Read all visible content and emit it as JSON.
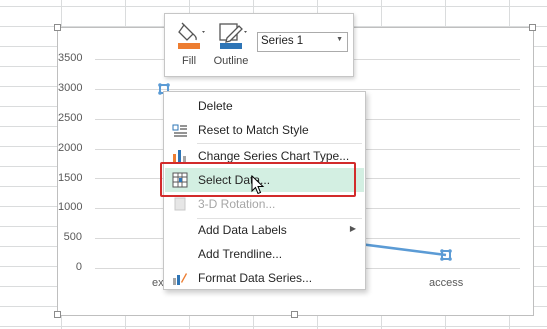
{
  "chart": {
    "y_axis_labels": [
      "3500",
      "3000",
      "2500",
      "2000",
      "1500",
      "1000",
      "500",
      "0"
    ],
    "x_axis_labels": [
      "ex",
      "access"
    ]
  },
  "mini_toolbar": {
    "fill_label": "Fill",
    "outline_label": "Outline",
    "series_select_value": "Series 1"
  },
  "context_menu": {
    "items": [
      {
        "label": "Delete",
        "enabled": true,
        "icon": "none"
      },
      {
        "label": "Reset to Match Style",
        "enabled": true,
        "icon": "reset-style-icon"
      },
      {
        "label": "Change Series Chart Type...",
        "enabled": true,
        "icon": "chart-type-icon"
      },
      {
        "label": "Select Data...",
        "enabled": true,
        "icon": "select-data-icon",
        "hovered": true
      },
      {
        "label": "3-D Rotation...",
        "enabled": false,
        "icon": "3d-rotation-icon"
      },
      {
        "label": "Add Data Labels",
        "enabled": true,
        "icon": "none",
        "submenu": true
      },
      {
        "label": "Add Trendline...",
        "enabled": true,
        "icon": "none"
      },
      {
        "label": "Format Data Series...",
        "enabled": true,
        "icon": "format-series-icon"
      }
    ]
  },
  "colors": {
    "series_line": "#5b9bd5",
    "highlight_border": "#d22b2b",
    "hover_background": "#d3efe2",
    "fill_swatch": "#ed7d31",
    "outline_swatch": "#2e75b6"
  }
}
